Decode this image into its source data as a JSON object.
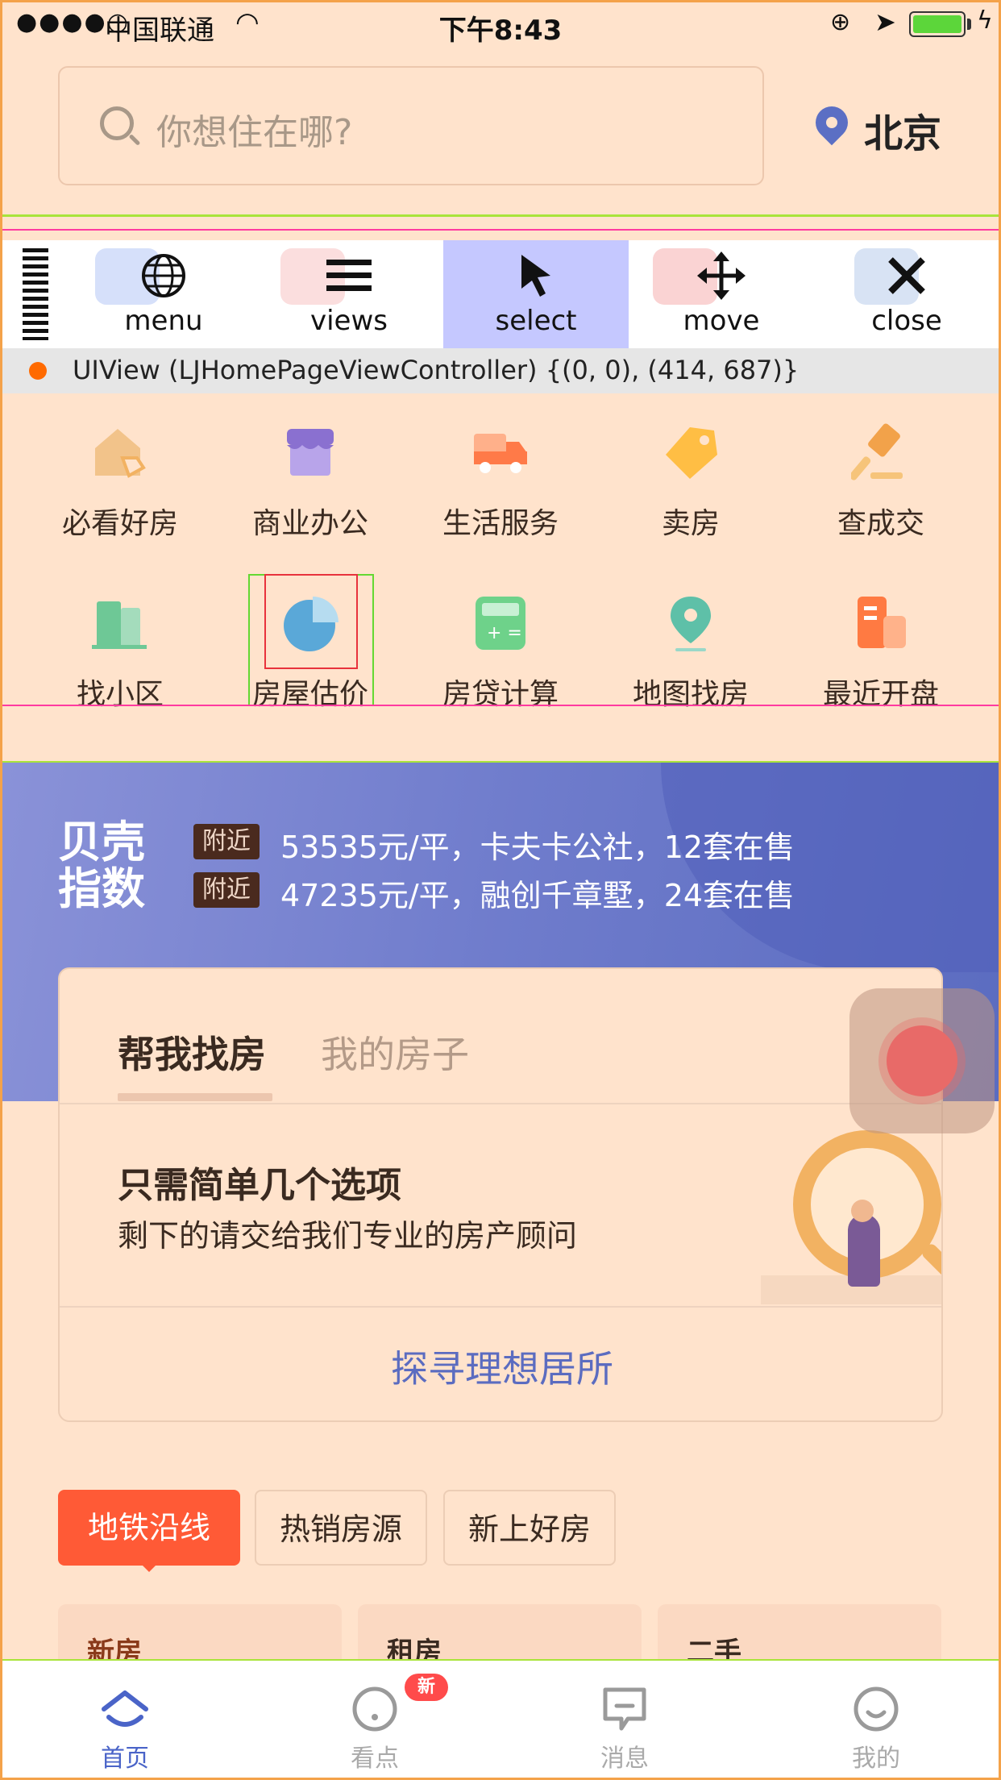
{
  "status_bar": {
    "signal": "●●●●○",
    "carrier": "中国联通",
    "time": "下午8:43"
  },
  "header": {
    "search_placeholder": "你想住在哪?",
    "city": "北京"
  },
  "flex_toolbar": {
    "tools": [
      {
        "label": "menu",
        "icon": "globe-icon"
      },
      {
        "label": "views",
        "icon": "hamburger-icon"
      },
      {
        "label": "select",
        "icon": "cursor-icon"
      },
      {
        "label": "move",
        "icon": "move-arrows-icon"
      },
      {
        "label": "close",
        "icon": "close-icon"
      }
    ],
    "selected_tool": "select"
  },
  "view_info": {
    "text": "UIView (LJHomePageViewController) {(0, 0), (414, 687)}"
  },
  "grid": {
    "row1": [
      "必看好房",
      "商业办公",
      "生活服务",
      "卖房",
      "查成交"
    ],
    "row2": [
      "找小区",
      "房屋估价",
      "房贷计算",
      "地图找房",
      "最近开盘"
    ]
  },
  "index_banner": {
    "title": "贝壳指数",
    "tag": "附近",
    "lines": [
      "53535元/平，卡夫卡公社，12套在售",
      "47235元/平，融创千章墅，24套在售"
    ]
  },
  "finder_card": {
    "tab_active": "帮我找房",
    "tab_inactive": "我的房子",
    "headline": "只需简单几个选项",
    "subtitle": "剩下的请交给我们专业的房产顾问",
    "cta": "探寻理想居所"
  },
  "chips": [
    "地铁沿线",
    "热销房源",
    "新上好房"
  ],
  "sub_cards": [
    "新房",
    "租房",
    "二手"
  ],
  "tab_bar": {
    "items": [
      "首页",
      "看点",
      "消息",
      "我的"
    ],
    "active": "首页",
    "badge": "新"
  },
  "colors": {
    "background": "#ffe3cc",
    "accent_blue": "#5b6cc0",
    "chip_active": "#ff5a36",
    "toolbar_selected": "#c5c8ff"
  }
}
